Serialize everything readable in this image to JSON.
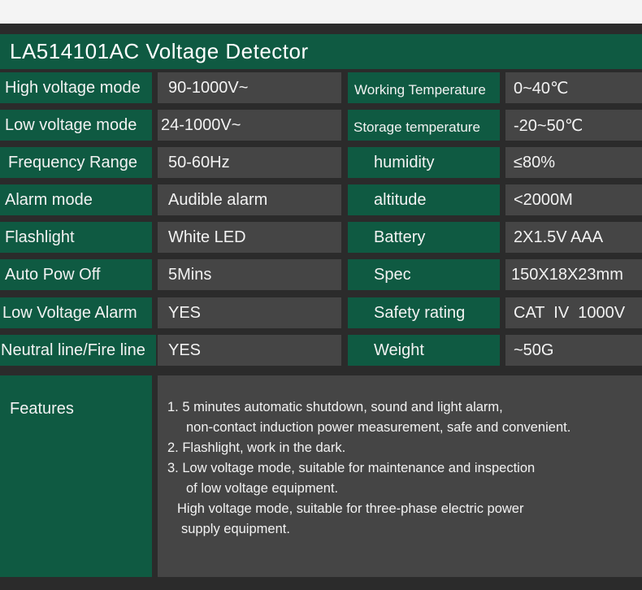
{
  "title": {
    "model": "LA514101",
    "name": "AC Voltage Detector"
  },
  "rows": [
    {
      "label1": "High voltage mode",
      "value1": "90-1000V~",
      "label2": "Working Temperature",
      "value2": "0~40℃"
    },
    {
      "label1": "Low voltage mode",
      "value1": "24-1000V~",
      "label2": "Storage temperature",
      "value2": "-20~50℃"
    },
    {
      "label1": "Frequency Range",
      "value1": "50-60Hz",
      "label2": "humidity",
      "value2": "≤80%"
    },
    {
      "label1": "Alarm mode",
      "value1": "Audible alarm",
      "label2": "altitude",
      "value2": "<2000M"
    },
    {
      "label1": "Flashlight",
      "value1": "White LED",
      "label2": "Battery",
      "value2": "2X1.5V AAA"
    },
    {
      "label1": "Auto Pow Off",
      "value1": "5Mins",
      "label2": "Spec",
      "value2": "150X18X23mm"
    },
    {
      "label1": "Low Voltage Alarm",
      "value1": "YES",
      "label2": "Safety rating",
      "value2": "CAT  IV  1000V"
    },
    {
      "label1": "Neutral line/Fire line",
      "value1": "YES",
      "label2": "Weight",
      "value2": "~50G"
    }
  ],
  "features": {
    "label": "Features",
    "lines": [
      "1. 5 minutes automatic shutdown, sound and light alarm,",
      "non-contact induction power measurement, safe and convenient.",
      "2. Flashlight, work in the dark.",
      "3. Low voltage mode, suitable for maintenance and inspection",
      "of low voltage equipment.",
      "High voltage mode, suitable for three-phase electric power",
      "supply equipment."
    ]
  }
}
